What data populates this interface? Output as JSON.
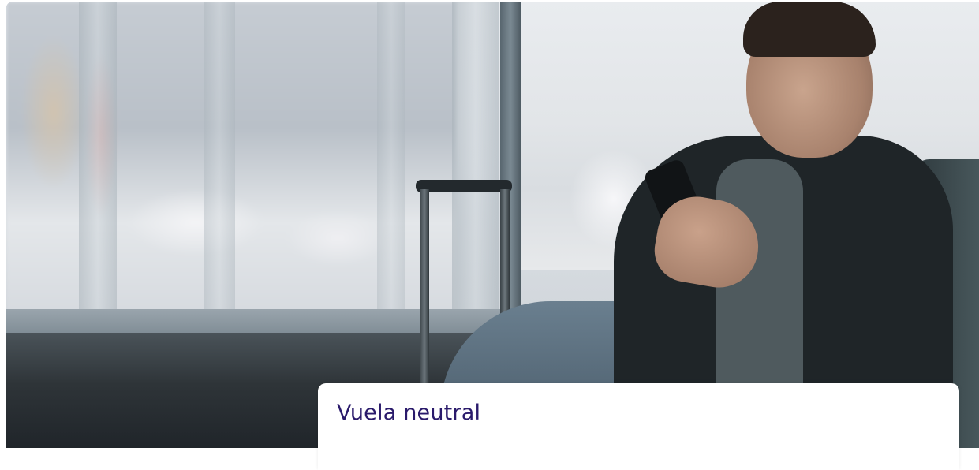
{
  "card": {
    "title": "Vuela neutral"
  },
  "colors": {
    "title_text": "#2a1a6b",
    "card_background": "#ffffff"
  },
  "hero": {
    "image_subject": "traveler-with-phone-and-suitcase"
  }
}
